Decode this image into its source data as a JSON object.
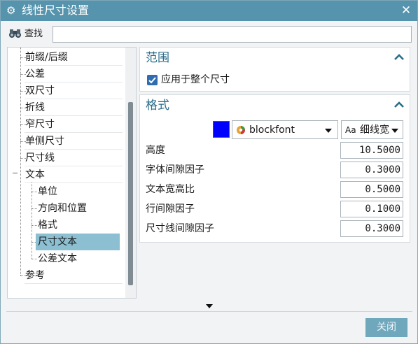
{
  "window": {
    "title": "线性尺寸设置",
    "icon": "gear-icon",
    "close_icon": "close-icon"
  },
  "search": {
    "label": "查找",
    "value": "",
    "placeholder": ""
  },
  "tree": {
    "items": [
      {
        "label": "前缀/后缀",
        "level": 1
      },
      {
        "label": "公差",
        "level": 1
      },
      {
        "label": "双尺寸",
        "level": 1
      },
      {
        "label": "折线",
        "level": 1
      },
      {
        "label": "窄尺寸",
        "level": 1
      },
      {
        "label": "单侧尺寸",
        "level": 1
      },
      {
        "label": "尺寸线",
        "level": 1
      },
      {
        "label": "文本",
        "level": 1,
        "expanded": true
      },
      {
        "label": "单位",
        "level": 2
      },
      {
        "label": "方向和位置",
        "level": 2
      },
      {
        "label": "格式",
        "level": 2
      },
      {
        "label": "尺寸文本",
        "level": 2,
        "selected": true
      },
      {
        "label": "公差文本",
        "level": 2
      },
      {
        "label": "参考",
        "level": 1
      }
    ]
  },
  "sections": {
    "range": {
      "title": "范围",
      "apply_label": "应用于整个尺寸",
      "apply_checked": true
    },
    "format": {
      "title": "格式",
      "color": "#0000ff",
      "font_name": "blockfont",
      "style_icon_text": "Aa",
      "style_value": "细线宽",
      "props": [
        {
          "label": "高度",
          "value": "10.5000"
        },
        {
          "label": "字体间隙因子",
          "value": "0.3000"
        },
        {
          "label": "文本宽高比",
          "value": "0.5000"
        },
        {
          "label": "行间隙因子",
          "value": "0.1000"
        },
        {
          "label": "尺寸线间隙因子",
          "value": "0.3000"
        }
      ]
    }
  },
  "footer": {
    "close_label": "关闭"
  },
  "colors": {
    "titlebar": "#5694ad",
    "accent": "#2a6d8a",
    "selected": "#8bbfd1",
    "button": "#6fa7bd"
  }
}
